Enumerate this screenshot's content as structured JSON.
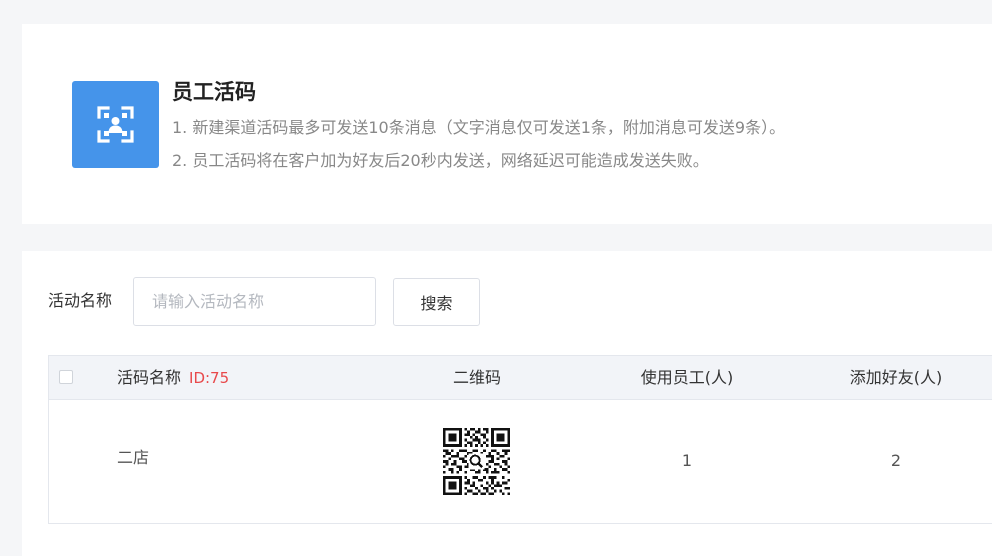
{
  "info": {
    "title": "员工活码",
    "line1": "1. 新建渠道活码最多可发送10条消息（文字消息仅可发送1条，附加消息可发送9条）。",
    "line2": "2. 员工活码将在客户加为好友后20秒内发送，网络延迟可能造成发送失败。",
    "icon": "qr-user-icon",
    "icon_bg": "#4594ea"
  },
  "search": {
    "label": "活动名称",
    "placeholder": "请输入活动名称",
    "value": "",
    "button_label": "搜索"
  },
  "table": {
    "columns": {
      "name": "活码名称",
      "id_label": "ID:75",
      "qrcode": "二维码",
      "staff": "使用员工(人)",
      "friends": "添加好友(人)"
    },
    "rows": [
      {
        "name": "二店",
        "staff": "1",
        "friends": "2"
      }
    ]
  },
  "colors": {
    "accent": "#4594ea",
    "id_red": "#e8494b"
  }
}
